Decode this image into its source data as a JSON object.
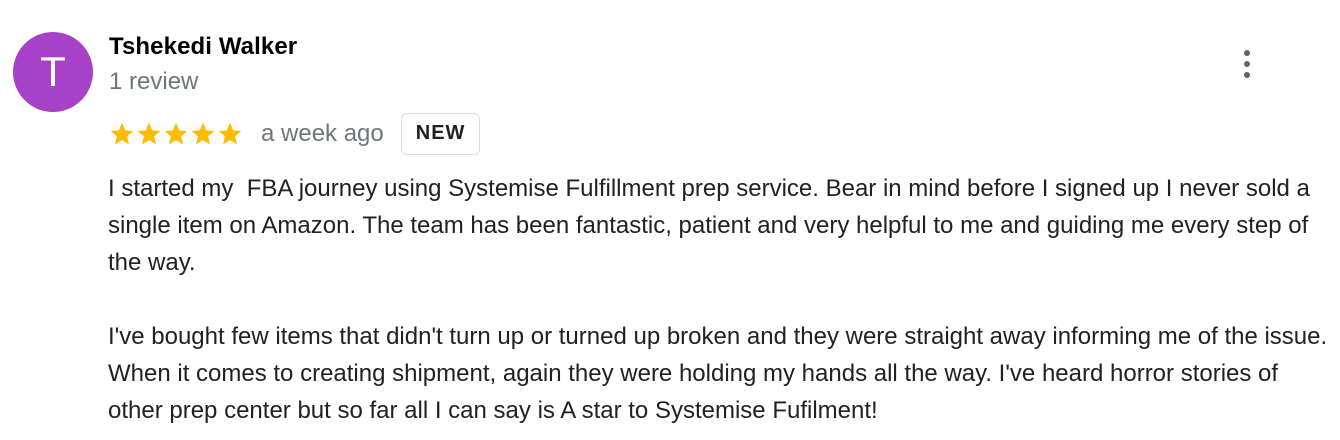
{
  "reviewer": {
    "initial": "T",
    "name": "Tshekedi Walker",
    "review_count": "1 review",
    "avatar_color": "#a641c8"
  },
  "rating": {
    "stars": 5,
    "max_stars": 5,
    "star_color": "#fbbc04"
  },
  "review": {
    "date": "a week ago",
    "badge": "NEW",
    "paragraph_1": "I started my  FBA journey using Systemise Fulfillment prep service. Bear in mind before I signed up I never sold a single item on Amazon. The team has been fantastic, patient and very helpful to me and guiding me every step of the way.",
    "paragraph_2": "I've bought few items that didn't turn up or turned up broken and they were straight away informing me of the issue. When it comes to creating shipment, again they were holding my hands all the way. I've heard horror stories of other prep center but so far all I can say is A star to Systemise Fufilment!"
  },
  "actions": {
    "more_icon": "more-vert-icon"
  }
}
